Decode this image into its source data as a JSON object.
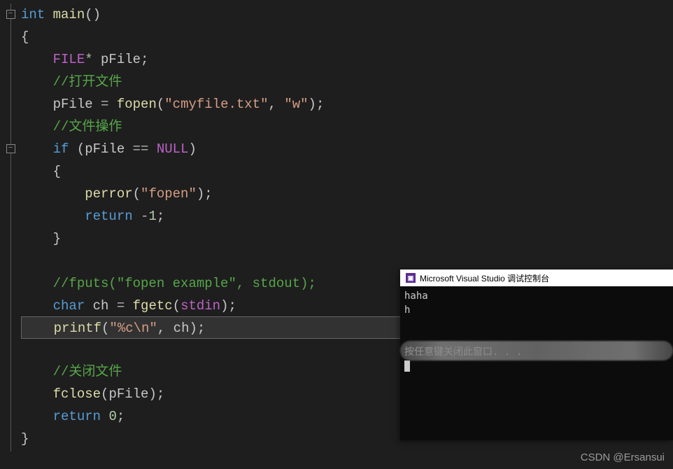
{
  "code": {
    "lines": [
      {
        "indent": 0,
        "tokens": [
          {
            "t": "int ",
            "c": "keyword"
          },
          {
            "t": "main",
            "c": "call"
          },
          {
            "t": "()",
            "c": "paren"
          }
        ]
      },
      {
        "indent": 0,
        "tokens": [
          {
            "t": "{",
            "c": "brace"
          }
        ]
      },
      {
        "indent": 1,
        "tokens": [
          {
            "t": "FILE",
            "c": "macro"
          },
          {
            "t": "* ",
            "c": "operator"
          },
          {
            "t": "pFile",
            "c": "identifier"
          },
          {
            "t": ";",
            "c": "semicolon"
          }
        ]
      },
      {
        "indent": 1,
        "tokens": [
          {
            "t": "//打开文件",
            "c": "comment"
          }
        ]
      },
      {
        "indent": 1,
        "tokens": [
          {
            "t": "pFile ",
            "c": "identifier"
          },
          {
            "t": "= ",
            "c": "operator"
          },
          {
            "t": "fopen",
            "c": "call"
          },
          {
            "t": "(",
            "c": "paren"
          },
          {
            "t": "\"cmyfile.txt\"",
            "c": "string"
          },
          {
            "t": ", ",
            "c": "punct"
          },
          {
            "t": "\"w\"",
            "c": "string"
          },
          {
            "t": ")",
            "c": "paren"
          },
          {
            "t": ";",
            "c": "semicolon"
          }
        ]
      },
      {
        "indent": 1,
        "tokens": [
          {
            "t": "//文件操作",
            "c": "comment"
          }
        ]
      },
      {
        "indent": 1,
        "tokens": [
          {
            "t": "if ",
            "c": "keyword"
          },
          {
            "t": "(",
            "c": "paren"
          },
          {
            "t": "pFile ",
            "c": "identifier"
          },
          {
            "t": "== ",
            "c": "operator"
          },
          {
            "t": "NULL",
            "c": "macro"
          },
          {
            "t": ")",
            "c": "paren"
          }
        ]
      },
      {
        "indent": 1,
        "tokens": [
          {
            "t": "{",
            "c": "brace"
          }
        ]
      },
      {
        "indent": 2,
        "tokens": [
          {
            "t": "perror",
            "c": "call"
          },
          {
            "t": "(",
            "c": "paren"
          },
          {
            "t": "\"fopen\"",
            "c": "string"
          },
          {
            "t": ")",
            "c": "paren"
          },
          {
            "t": ";",
            "c": "semicolon"
          }
        ]
      },
      {
        "indent": 2,
        "tokens": [
          {
            "t": "return ",
            "c": "keyword"
          },
          {
            "t": "-",
            "c": "operator"
          },
          {
            "t": "1",
            "c": "number"
          },
          {
            "t": ";",
            "c": "semicolon"
          }
        ]
      },
      {
        "indent": 1,
        "tokens": [
          {
            "t": "}",
            "c": "brace"
          }
        ]
      },
      {
        "indent": 0,
        "tokens": []
      },
      {
        "indent": 1,
        "tokens": [
          {
            "t": "//fputs(\"fopen example\", stdout);",
            "c": "comment"
          }
        ]
      },
      {
        "indent": 1,
        "tokens": [
          {
            "t": "char ",
            "c": "keyword"
          },
          {
            "t": "ch ",
            "c": "identifier"
          },
          {
            "t": "= ",
            "c": "operator"
          },
          {
            "t": "fgetc",
            "c": "call"
          },
          {
            "t": "(",
            "c": "paren"
          },
          {
            "t": "stdin",
            "c": "macro"
          },
          {
            "t": ")",
            "c": "paren"
          },
          {
            "t": ";",
            "c": "semicolon"
          }
        ]
      },
      {
        "indent": 1,
        "highlight": true,
        "tokens": [
          {
            "t": "printf",
            "c": "call"
          },
          {
            "t": "(",
            "c": "paren"
          },
          {
            "t": "\"%c\\n\"",
            "c": "string"
          },
          {
            "t": ", ",
            "c": "punct"
          },
          {
            "t": "ch",
            "c": "identifier"
          },
          {
            "t": ")",
            "c": "paren"
          },
          {
            "t": ";",
            "c": "semicolon"
          }
        ]
      },
      {
        "indent": 0,
        "tokens": []
      },
      {
        "indent": 1,
        "tokens": [
          {
            "t": "//关闭文件",
            "c": "comment"
          }
        ]
      },
      {
        "indent": 1,
        "tokens": [
          {
            "t": "fclose",
            "c": "call"
          },
          {
            "t": "(",
            "c": "paren"
          },
          {
            "t": "pFile",
            "c": "identifier"
          },
          {
            "t": ")",
            "c": "paren"
          },
          {
            "t": ";",
            "c": "semicolon"
          }
        ]
      },
      {
        "indent": 1,
        "tokens": [
          {
            "t": "return ",
            "c": "keyword"
          },
          {
            "t": "0",
            "c": "number"
          },
          {
            "t": ";",
            "c": "semicolon"
          }
        ]
      },
      {
        "indent": 0,
        "tokens": [
          {
            "t": "}",
            "c": "brace"
          }
        ]
      }
    ]
  },
  "gutter": {
    "fold_markers": [
      {
        "line": 0,
        "symbol": "−"
      },
      {
        "line": 6,
        "symbol": "−"
      }
    ]
  },
  "console": {
    "title": "Microsoft Visual Studio 调试控制台",
    "icon_text": "▣",
    "output": [
      "haha",
      "h",
      "",
      "",
      "按任意键关闭此窗口. . ."
    ]
  },
  "watermark": "CSDN @Ersansui"
}
